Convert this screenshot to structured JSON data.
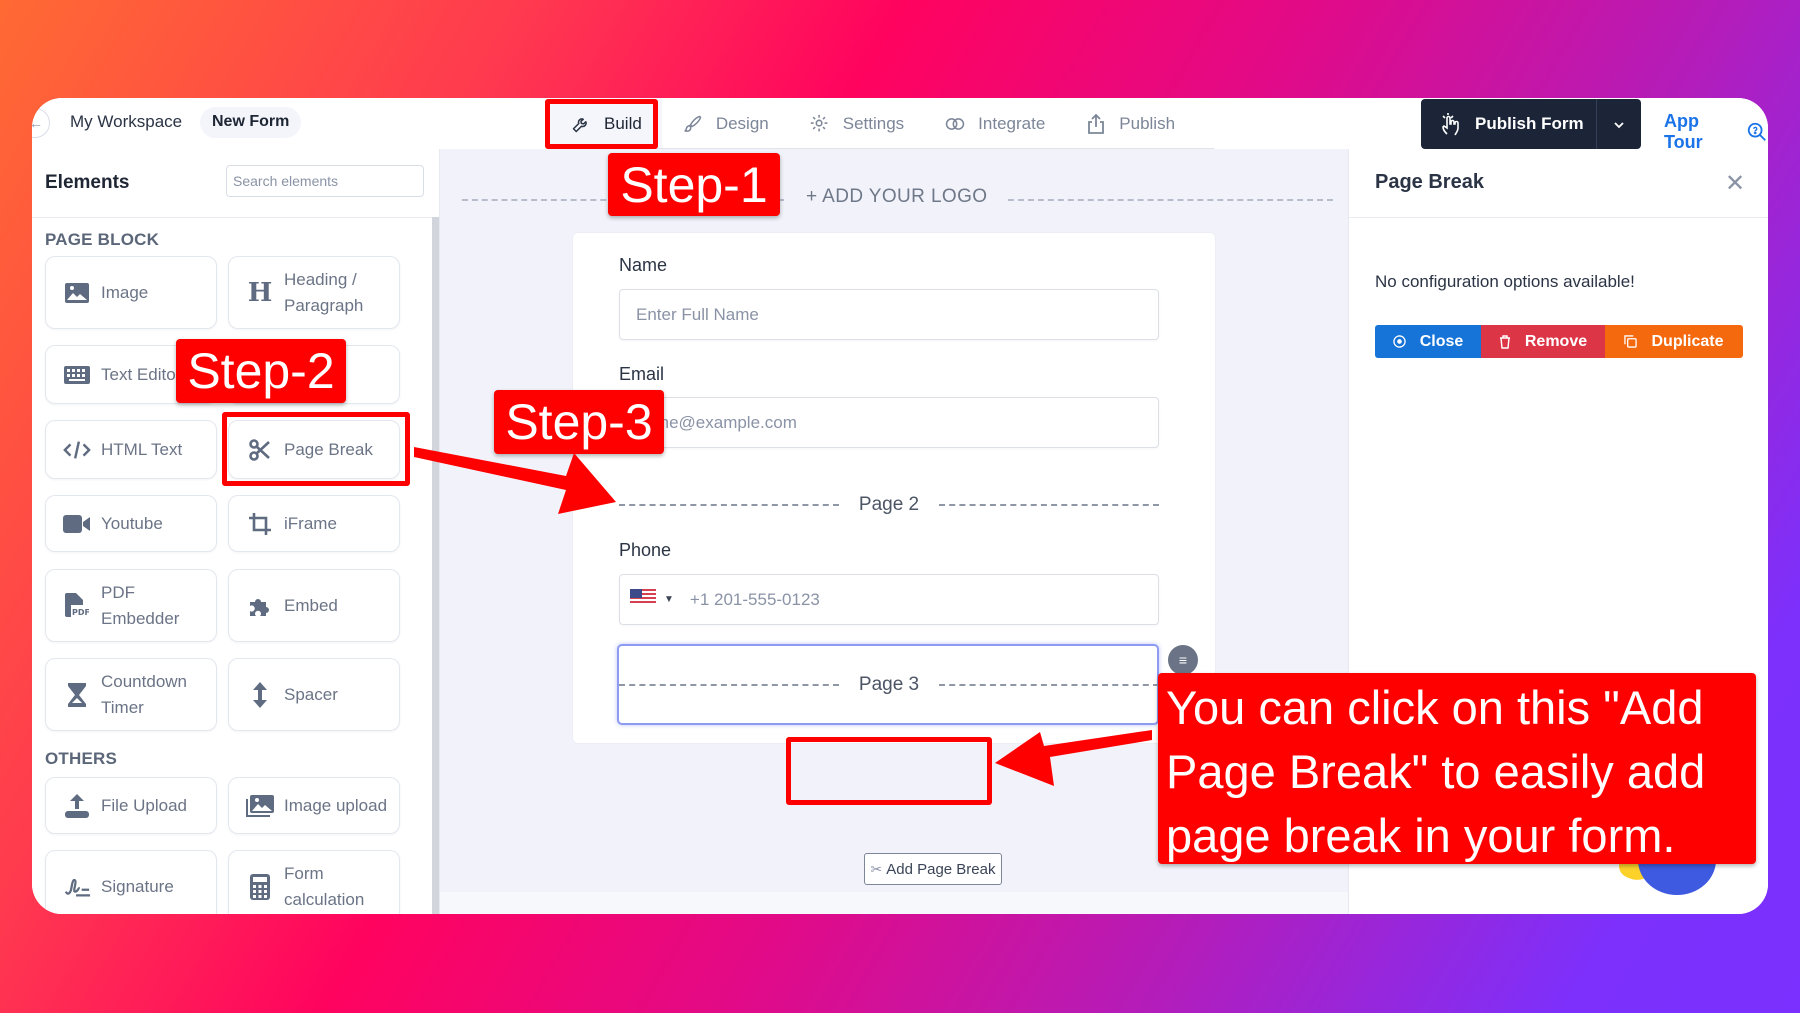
{
  "topbar": {
    "back_icon": "arrow-left-icon",
    "workspace": "My Workspace",
    "form_name": "New Form",
    "tabs": [
      {
        "label": "Build",
        "icon": "wrench-icon",
        "active": true
      },
      {
        "label": "Design",
        "icon": "brush-icon",
        "active": false
      },
      {
        "label": "Settings",
        "icon": "gear-icon",
        "active": false
      },
      {
        "label": "Integrate",
        "icon": "link-icon",
        "active": false
      },
      {
        "label": "Publish",
        "icon": "share-icon",
        "active": false
      }
    ],
    "publish_form": "Publish Form",
    "app_tour": "App Tour"
  },
  "sidebar": {
    "title": "Elements",
    "search_placeholder": "Search elements",
    "sections": [
      {
        "label": "PAGE BLOCK",
        "items": [
          {
            "label": "Image",
            "icon": "image-icon"
          },
          {
            "label": "Heading / Paragraph",
            "icon": "heading-icon"
          },
          {
            "label": "Text Editor",
            "icon": "keyboard-icon"
          },
          {
            "label": "",
            "icon": ""
          },
          {
            "label": "HTML Text",
            "icon": "code-icon"
          },
          {
            "label": "Page Break",
            "icon": "scissors-icon"
          },
          {
            "label": "Youtube",
            "icon": "video-icon"
          },
          {
            "label": "iFrame",
            "icon": "crop-icon"
          },
          {
            "label": "PDF Embedder",
            "icon": "pdf-file-icon"
          },
          {
            "label": "Embed",
            "icon": "puzzle-icon"
          },
          {
            "label": "Countdown Timer",
            "icon": "hourglass-icon"
          },
          {
            "label": "Spacer",
            "icon": "vertical-arrows-icon"
          }
        ]
      },
      {
        "label": "OTHERS",
        "items": [
          {
            "label": "File Upload",
            "icon": "upload-icon"
          },
          {
            "label": "Image upload",
            "icon": "images-icon"
          },
          {
            "label": "Signature",
            "icon": "signature-icon"
          },
          {
            "label": "Form calculation",
            "icon": "calculator-icon"
          }
        ]
      }
    ]
  },
  "canvas": {
    "add_logo": "+ ADD YOUR LOGO",
    "fields": [
      {
        "label": "Name",
        "placeholder": "Enter Full Name"
      },
      {
        "label": "Email",
        "placeholder": "name@example.com"
      },
      {
        "label": "Phone",
        "placeholder": "+1 201-555-0123",
        "country": "US"
      }
    ],
    "page_breaks": [
      "Page 2",
      "Page 3"
    ],
    "add_page_break": "Add Page Break"
  },
  "right_panel": {
    "title": "Page Break",
    "message": "No configuration options available!",
    "actions": {
      "close": "Close",
      "remove": "Remove",
      "duplicate": "Duplicate"
    },
    "colors": {
      "close": "#1673d8",
      "remove": "#dc3545",
      "duplicate": "#f5690e"
    }
  },
  "annotations": {
    "step1": "Step-1",
    "step2": "Step-2",
    "step3": "Step-3",
    "callout": "You can click on this \"Add Page Break\" to easily add page break in your form.",
    "color": "#ff0000"
  }
}
